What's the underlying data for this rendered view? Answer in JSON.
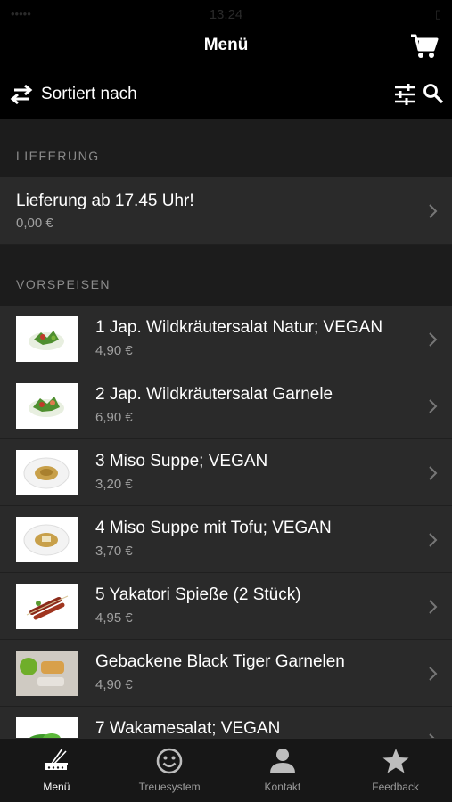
{
  "status_bar": {
    "left": "•••••",
    "time": "13:24",
    "right": "▯"
  },
  "nav": {
    "title": "Menü"
  },
  "toolbar": {
    "sort_label": "Sortiert nach"
  },
  "sections": [
    {
      "header": "LIEFERUNG",
      "items": [
        {
          "title": "Lieferung ab 17.45 Uhr!",
          "price": "0,00 €"
        }
      ]
    },
    {
      "header": "VORSPEISEN",
      "items": [
        {
          "title": "1 Jap. Wildkräutersalat Natur; VEGAN",
          "price": "4,90 €",
          "image": "salad"
        },
        {
          "title": "2 Jap. Wildkräutersalat Garnele",
          "price": "6,90 €",
          "image": "salad"
        },
        {
          "title": "3 Miso Suppe; VEGAN",
          "price": "3,20 €",
          "image": "soup"
        },
        {
          "title": "4 Miso Suppe mit Tofu; VEGAN",
          "price": "3,70 €",
          "image": "soup"
        },
        {
          "title": "5 Yakatori Spieße (2 Stück)",
          "price": "4,95 €",
          "image": "skewer"
        },
        {
          "title": "Gebackene Black Tiger Garnelen",
          "price": "4,90 €",
          "image": "prawn"
        },
        {
          "title": "7 Wakamesalat; VEGAN",
          "price": "",
          "image": "salad"
        }
      ]
    }
  ],
  "tabs": [
    {
      "label": "Menü",
      "icon": "chopsticks-bowl-icon",
      "active": true
    },
    {
      "label": "Treuesystem",
      "icon": "smiley-icon",
      "active": false
    },
    {
      "label": "Kontakt",
      "icon": "person-icon",
      "active": false
    },
    {
      "label": "Feedback",
      "icon": "star-icon",
      "active": false
    }
  ],
  "colors": {
    "background": "#000000",
    "list_background": "#1c1c1c",
    "row_background": "#2a2a2a",
    "secondary_text": "#a0a0a0",
    "section_header_text": "#8a8a8a"
  }
}
